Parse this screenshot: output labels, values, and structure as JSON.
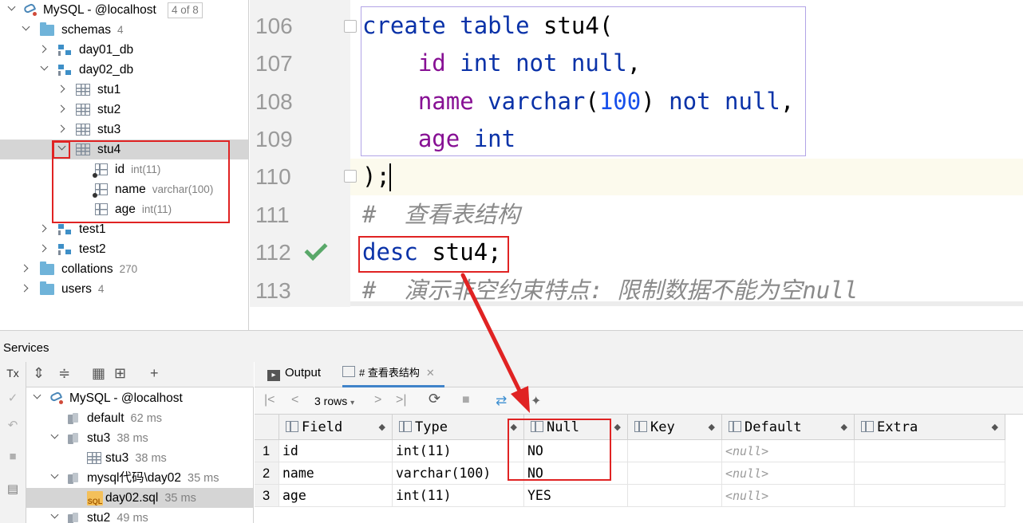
{
  "db_tree": {
    "root": {
      "label": "MySQL - @localhost",
      "badge": "4 of 8"
    },
    "schemas": {
      "label": "schemas",
      "count": "4"
    },
    "day01": {
      "label": "day01_db"
    },
    "day02": {
      "label": "day02_db"
    },
    "tables": [
      {
        "label": "stu1"
      },
      {
        "label": "stu2"
      },
      {
        "label": "stu3"
      },
      {
        "label": "stu4"
      }
    ],
    "columns": [
      {
        "name": "id",
        "type": "int(11)"
      },
      {
        "name": "name",
        "type": "varchar(100)"
      },
      {
        "name": "age",
        "type": "int(11)"
      }
    ],
    "more_tables": [
      {
        "label": "test1"
      },
      {
        "label": "test2"
      }
    ],
    "collations": {
      "label": "collations",
      "count": "270"
    },
    "users": {
      "label": "users",
      "count": "4"
    }
  },
  "editor": {
    "line_numbers": [
      "106",
      "107",
      "108",
      "109",
      "110",
      "111",
      "112",
      "113"
    ],
    "code": {
      "l106_a": "create",
      "l106_b": "table",
      "l106_c": "stu4(",
      "l107_a": "id",
      "l107_b": "int",
      "l107_c": "not null",
      "l108_a": "name",
      "l108_b": "varchar",
      "l108_c": "100",
      "l108_d": "not null",
      "l109_a": "age",
      "l109_b": "int",
      "l110": ");",
      "l111": "#  查看表结构",
      "l112_a": "desc",
      "l112_b": "stu4;",
      "l113_a": "#  演示非空约束特点: 限制数据不能为空",
      "l113_b": "null"
    }
  },
  "services": {
    "title": "Services",
    "tx_label": "Tx",
    "tree": [
      {
        "label": "MySQL - @localhost",
        "meta": ""
      },
      {
        "label": "default",
        "meta": "62 ms"
      },
      {
        "label": "stu3",
        "meta": "38 ms"
      },
      {
        "label": "stu3",
        "meta": "38 ms"
      },
      {
        "label": "mysql代码\\day02",
        "meta": "35 ms"
      },
      {
        "label": "day02.sql",
        "meta": "35 ms"
      },
      {
        "label": "stu2",
        "meta": "49 ms"
      }
    ]
  },
  "results": {
    "tabs": [
      {
        "label": "Output"
      },
      {
        "label": "# 查看表结构"
      }
    ],
    "rows_label": "3 rows",
    "columns": [
      "Field",
      "Type",
      "Null",
      "Key",
      "Default",
      "Extra"
    ],
    "rows": [
      {
        "n": "1",
        "field": "id",
        "type": "int(11)",
        "null": "NO",
        "key": "",
        "default": "<null>",
        "extra": ""
      },
      {
        "n": "2",
        "field": "name",
        "type": "varchar(100)",
        "null": "NO",
        "key": "",
        "default": "<null>",
        "extra": ""
      },
      {
        "n": "3",
        "field": "age",
        "type": "int(11)",
        "null": "YES",
        "key": "",
        "default": "<null>",
        "extra": ""
      }
    ]
  },
  "colors": {
    "keyword": "#0a32a8",
    "field": "#871094",
    "number": "#1750eb",
    "annotation_red": "#e02323",
    "success_check": "#59a869",
    "selection": "#d5d5d5"
  }
}
